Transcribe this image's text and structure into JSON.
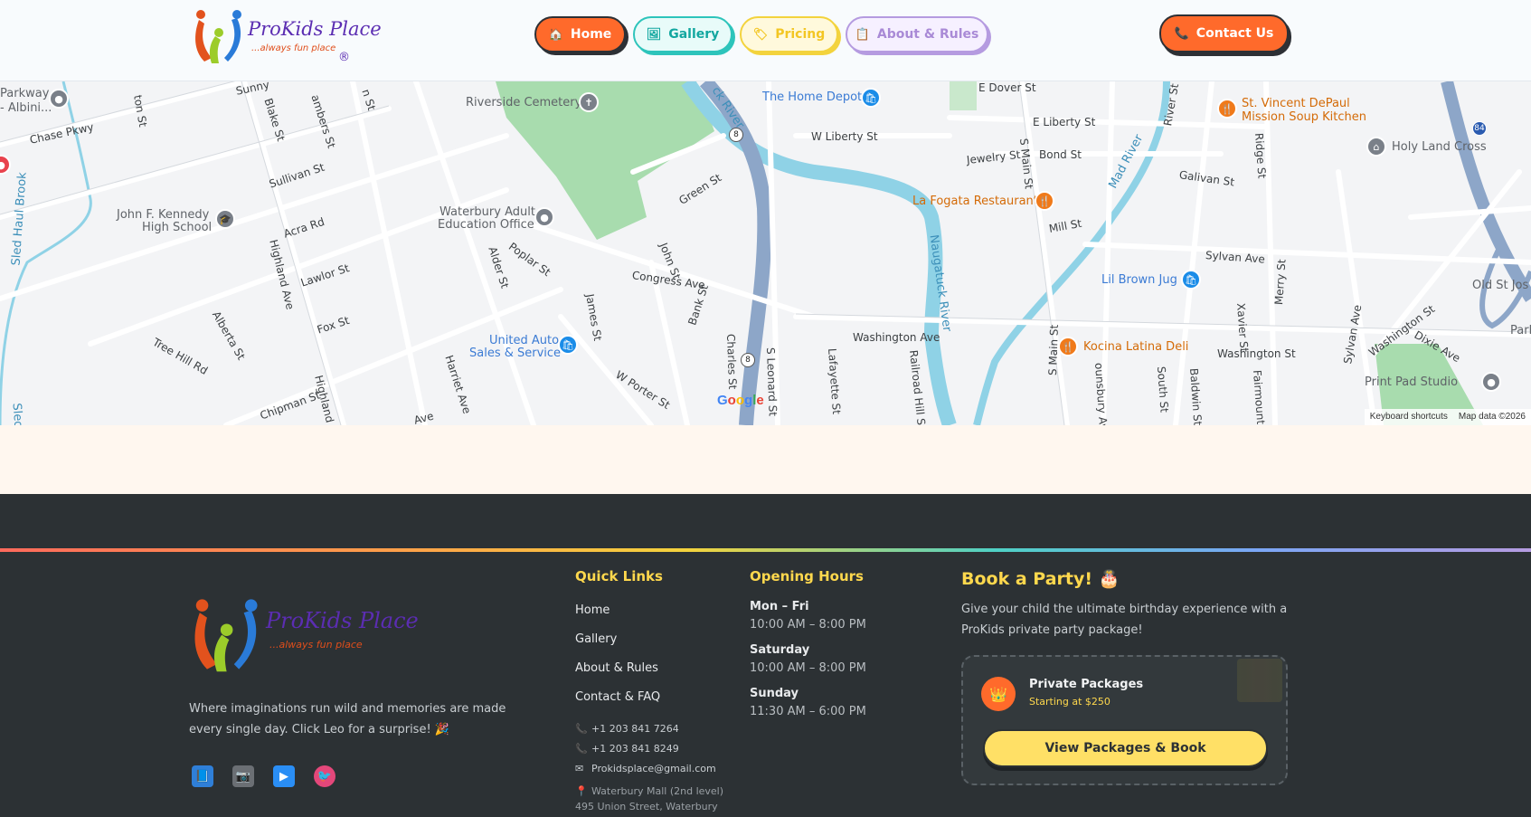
{
  "header": {
    "logo": {
      "name": "ProKids Place",
      "tagline": "...always fun place",
      "reg": "®"
    },
    "nav": [
      {
        "label": "Home",
        "icon": "🏠"
      },
      {
        "label": "Gallery",
        "icon": "🖼"
      },
      {
        "label": "Pricing",
        "icon": "🏷"
      },
      {
        "label": "About & Rules",
        "icon": "📋"
      }
    ],
    "contact": {
      "label": "Contact Us",
      "icon": "📞"
    }
  },
  "map": {
    "pois": {
      "parkway": "Parkway",
      "albini": "- Albini...",
      "riverside": "Riverside Cemetery",
      "home_depot": "The Home Depot",
      "st_vincent_1": "St. Vincent DePaul",
      "st_vincent_2": "Mission Soup Kitchen",
      "holy_land": "Holy Land Cross",
      "jfk_1": "John F. Kennedy",
      "jfk_2": "High School",
      "waterbury_adult_1": "Waterbury Adult",
      "waterbury_adult_2": "Education Office",
      "la_fogata": "La Fogata Restaurant",
      "lil_brown": "Lil Brown Jug",
      "old_st_jos": "Old St Jos",
      "united_auto_1": "United Auto",
      "united_auto_2": "Sales & Service",
      "kocina": "Kocina Latina Deli",
      "print_pad": "Print Pad Studio",
      "park": "Park"
    },
    "streets": {
      "chase_pkwy": "Chase Pkwy",
      "sunny": "Sunny",
      "blake": "Blake St",
      "chambers": "ambers St",
      "ton_st": "ton St",
      "n_st": "n St",
      "sullivan": "Sullivan St",
      "acra": "Acra Rd",
      "lawlor": "Lawlor St",
      "fox": "Fox St",
      "alberta": "Alberta St",
      "tree_hill": "Tree Hill Rd",
      "chipman": "Chipman St",
      "highland": "Highland Ave",
      "highland2": "Highland A",
      "ave": "Ave",
      "harriet": "Harriet Ave",
      "alder": "Alder St",
      "poplar": "Poplar St",
      "green": "Green St",
      "john": "John St",
      "congress": "Congress Ave",
      "james": "James St",
      "w_porter": "W Porter St",
      "bank": "Bank St",
      "charles": "Charles St",
      "s_leonard": "S Leonard St",
      "lafayette": "Lafayette St",
      "railroad": "Railroad Hill St",
      "washington_ave": "Washington Ave",
      "w_liberty": "W Liberty St",
      "e_dover": "E Dover St",
      "e_liberty": "E Liberty St",
      "jewelry": "Jewelry St",
      "bond": "Bond St",
      "s_main": "S Main St",
      "s_main2": "S Main St",
      "mill": "Mill St",
      "galivan": "Galivan St",
      "sylvan": "Sylvan Ave",
      "sylvan2": "Sylvan Ave",
      "river_st": "River St",
      "ridge": "Ridge St",
      "xavier": "Xavier St",
      "merry": "Merry St",
      "washington_st": "Washington St",
      "washington_st2": "Washington St",
      "dixie": "Dixie Ave",
      "south_st": "South St",
      "baldwin": "Baldwin St",
      "fairmount": "Fairmount S",
      "dunsbury": "ounsbury Ave",
      "sled_haul": "Sled Haul Brook",
      "sled": "Sled",
      "river_label": "ck River",
      "naugatuck": "Naugatuck River",
      "mad_river": "Mad River"
    },
    "shields": [
      "8",
      "8",
      "8",
      "84"
    ],
    "google": "Google",
    "keyboard_shortcuts": "Keyboard shortcuts",
    "map_data": "Map data ©2026"
  },
  "footer": {
    "logo": {
      "name": "ProKids Place",
      "tagline": "...always fun place"
    },
    "description": "Where imaginations run wild and memories are made every single day. Click Leo for a surprise! 🎉",
    "socials": [
      {
        "icon": "📘"
      },
      {
        "icon": "📷"
      },
      {
        "icon": "▶"
      },
      {
        "icon": "🐦"
      }
    ],
    "quick_links": {
      "title": "Quick Links",
      "items": [
        "Home",
        "Gallery",
        "About & Rules",
        "Contact & FAQ"
      ]
    },
    "contact": {
      "phone1": "+1 203 841 7264",
      "phone2": "+1 203 841 8249",
      "email": "Prokidsplace@gmail.com",
      "address1": "Waterbury Mall (2nd level)",
      "address2": "495 Union Street, Waterbury",
      "phone_icon": "📞",
      "email_icon": "✉",
      "pin_icon": "📍"
    },
    "hours": {
      "title": "Opening Hours",
      "days": [
        {
          "day": "Mon – Fri",
          "time": "10:00 AM – 8:00 PM"
        },
        {
          "day": "Saturday",
          "time": "10:00 AM – 8:00 PM"
        },
        {
          "day": "Sunday",
          "time": "11:30 AM – 6:00 PM"
        }
      ]
    },
    "party": {
      "title": "Book a Party! 🎂",
      "description": "Give your child the ultimate birthday experience with a ProKids private party package!",
      "package_name": "Private Packages",
      "package_price": "Starting at $250",
      "package_icon": "👑",
      "button": "View Packages & Book"
    }
  }
}
